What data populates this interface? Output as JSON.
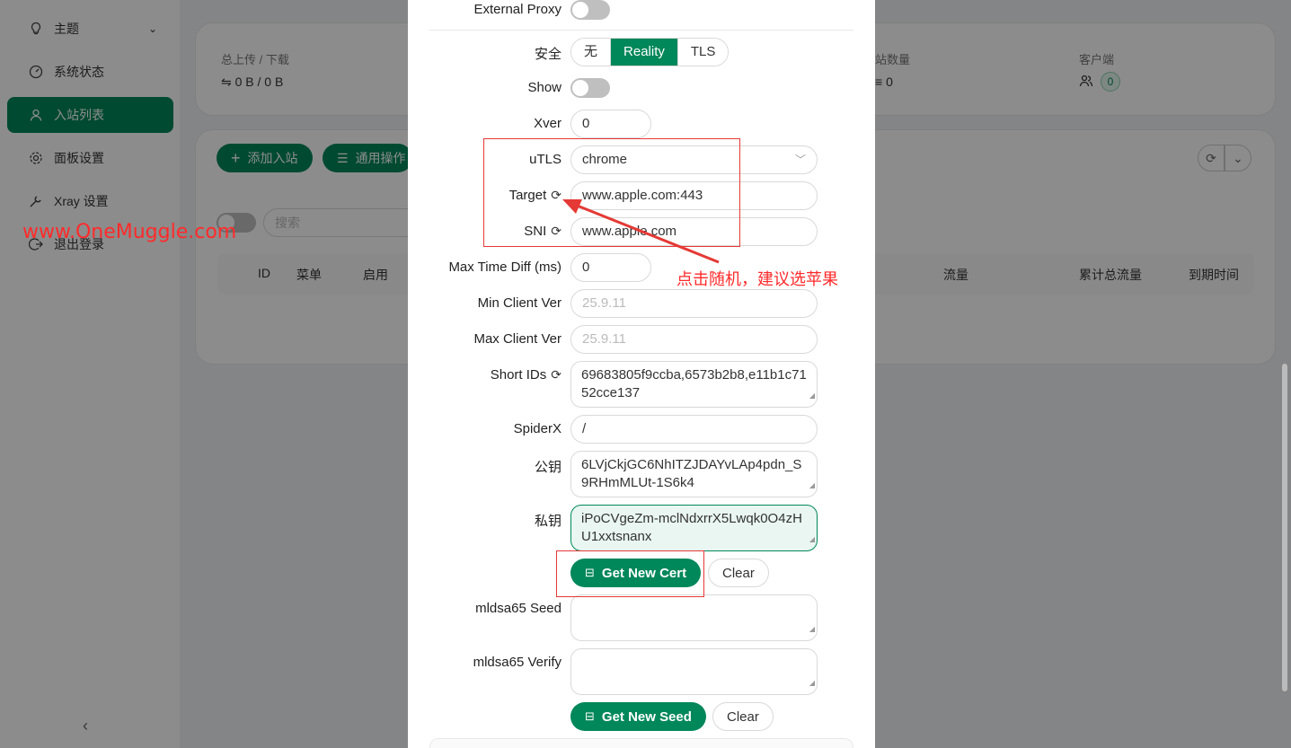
{
  "sidebar": {
    "items": [
      {
        "label": "主题",
        "icon": "lightbulb-icon"
      },
      {
        "label": "系统状态",
        "icon": "dashboard-icon"
      },
      {
        "label": "入站列表",
        "icon": "user-icon"
      },
      {
        "label": "面板设置",
        "icon": "gear-icon"
      },
      {
        "label": "Xray 设置",
        "icon": "wrench-icon"
      },
      {
        "label": "退出登录",
        "icon": "logout-icon"
      }
    ],
    "collapse": "‹"
  },
  "stats": {
    "traffic_label": "总上传 / 下载",
    "traffic_value": "0 B / 0 B",
    "inbound_count_label": "站数量",
    "inbound_count_value": "0",
    "clients_label": "客户端",
    "clients_value": "0"
  },
  "toolbar": {
    "add_inbound": "添加入站",
    "general_actions": "通用操作",
    "search_placeholder": "搜索"
  },
  "table": {
    "headers": [
      "ID",
      "菜单",
      "启用",
      "流量",
      "累计总流量",
      "到期时间"
    ]
  },
  "watermark": "www.OneMuggle.com",
  "form": {
    "external_proxy_label": "External Proxy",
    "security_label": "安全",
    "security_options": [
      "无",
      "Reality",
      "TLS"
    ],
    "security_selected": "Reality",
    "show_label": "Show",
    "xver_label": "Xver",
    "xver_value": "0",
    "utls_label": "uTLS",
    "utls_value": "chrome",
    "target_label": "Target",
    "target_value": "www.apple.com:443",
    "sni_label": "SNI",
    "sni_value": "www.apple.com",
    "max_time_diff_label": "Max Time Diff (ms)",
    "max_time_diff_value": "0",
    "min_client_ver_label": "Min Client Ver",
    "min_client_ver_placeholder": "25.9.11",
    "max_client_ver_label": "Max Client Ver",
    "max_client_ver_placeholder": "25.9.11",
    "short_ids_label": "Short IDs",
    "short_ids_value": "69683805f9ccba,6573b2b8,e11b1c7152cce137",
    "spiderx_label": "SpiderX",
    "spiderx_value": "/",
    "public_key_label": "公钥",
    "public_key_value": "6LVjCkjGC6NhITZJDAYvLAp4pdn_S9RHmMLUt-1S6k4",
    "private_key_label": "私钥",
    "private_key_value": "iPoCVgeZm-mclNdxrrX5Lwqk0O4zHU1xxtsnanx",
    "get_new_cert": "Get New Cert",
    "clear": "Clear",
    "mldsa_seed_label": "mldsa65 Seed",
    "mldsa_verify_label": "mldsa65 Verify",
    "get_new_seed": "Get New Seed",
    "clear2": "Clear"
  },
  "annotation": {
    "text": "点击随机，建议选苹果",
    "color": "#ff2a2a"
  },
  "colors": {
    "accent": "#00875a"
  }
}
